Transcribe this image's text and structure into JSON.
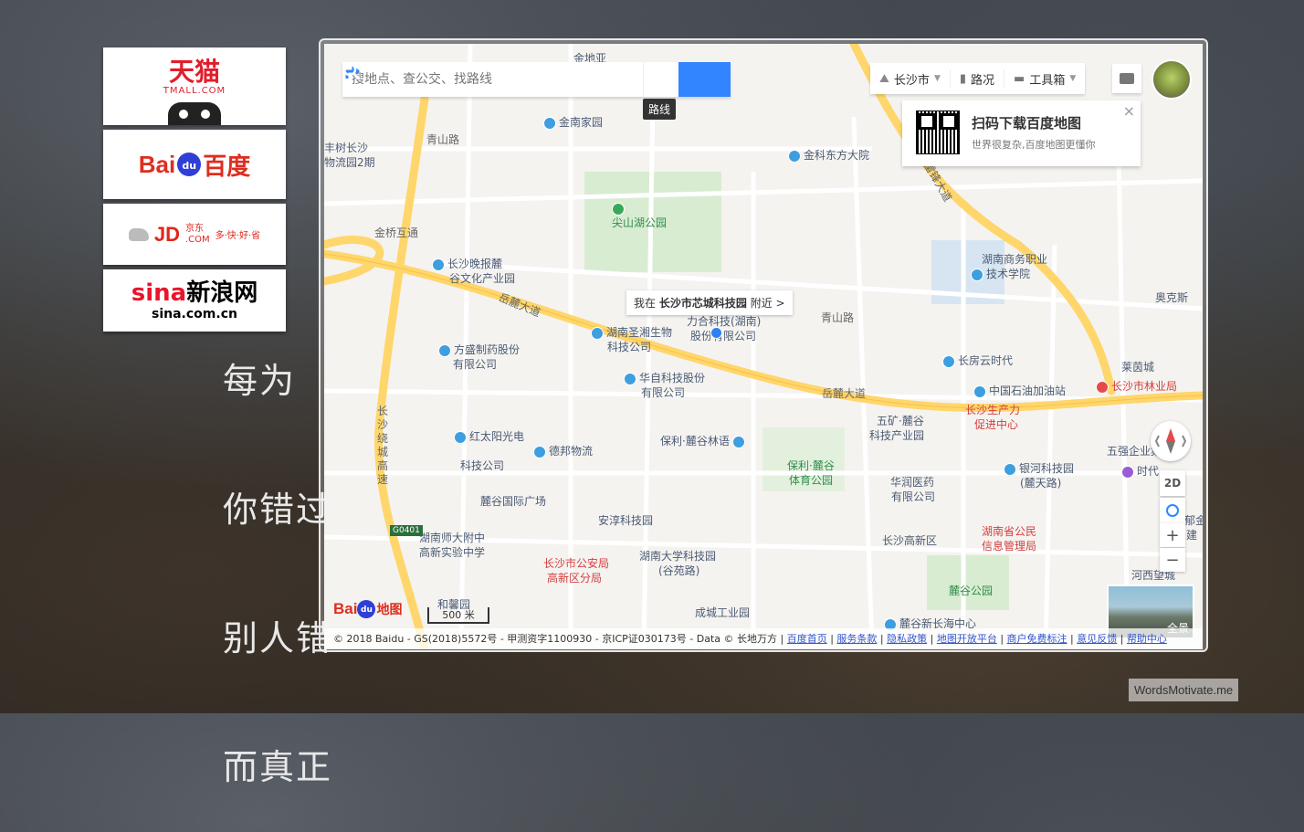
{
  "background_text": [
    "每为",
    "你错过",
    "别人错",
    "而真正"
  ],
  "links": {
    "tmall": {
      "cn": "天猫",
      "en": "TMALL.COM"
    },
    "baidu": {
      "left": "Bai",
      "paw": "du",
      "right": "百度"
    },
    "jd": {
      "logo": "JD",
      "cn": "京东",
      "com": ".COM",
      "slogan": "多·快·好·省"
    },
    "sina": {
      "logo_red": "sina",
      "logo_black": "新浪网",
      "url": "sina.com.cn"
    }
  },
  "search": {
    "placeholder": "搜地点、查公交、找路线",
    "route_tooltip": "路线",
    "route_icon": "route-arrow-icon",
    "search_icon": "magnifier-icon"
  },
  "toolbar": {
    "city": "长沙市",
    "traffic": "路况",
    "tools": "工具箱"
  },
  "qr_card": {
    "title": "扫码下载百度地图",
    "subtitle": "世界很复杂,百度地图更懂你",
    "close": "×"
  },
  "location_tip": {
    "prefix": "我在",
    "place": "长沙市芯城科技园",
    "suffix": "附近 >"
  },
  "controls": {
    "mode": "2D",
    "zoom_in": "+",
    "zoom_out": "−",
    "overview": "全景"
  },
  "scale": "500 米",
  "logo": {
    "bai": "Bai",
    "du": "du",
    "map": "地图"
  },
  "copyright": {
    "text": "© 2018 Baidu - GS(2018)5572号 - 甲测资字1100930 - 京ICP证030173号 - Data © 长地万方 |",
    "links": [
      "百度首页",
      "服务条款",
      "隐私政策",
      "地图开放平台",
      "商户免费标注",
      "意见反馈",
      "帮助中心"
    ]
  },
  "map_labels": [
    {
      "text": "金地亚",
      "type": "poi"
    },
    {
      "text": "金南家园",
      "type": "poi"
    },
    {
      "text": "青山路",
      "type": "road"
    },
    {
      "text": "丰树长沙",
      "type": "poi"
    },
    {
      "text": "物流园2期",
      "type": "poi"
    },
    {
      "text": "金科东方大院",
      "type": "poi"
    },
    {
      "text": "尖山湖公园",
      "type": "park"
    },
    {
      "text": "金桥互通",
      "type": "road"
    },
    {
      "text": "长沙晚报麓",
      "type": "poi"
    },
    {
      "text": "谷文化产业园",
      "type": "poi"
    },
    {
      "text": "岳麓大道",
      "type": "road"
    },
    {
      "text": "湖南圣湘生物",
      "type": "poi"
    },
    {
      "text": "科技公司",
      "type": "poi"
    },
    {
      "text": "力合科技(湖南)",
      "type": "poi"
    },
    {
      "text": "股份有限公司",
      "type": "poi"
    },
    {
      "text": "青山路",
      "type": "road"
    },
    {
      "text": "方盛制药股份",
      "type": "poi"
    },
    {
      "text": "有限公司",
      "type": "poi"
    },
    {
      "text": "华自科技股份",
      "type": "poi"
    },
    {
      "text": "有限公司",
      "type": "poi"
    },
    {
      "text": "岳麓大道",
      "type": "road"
    },
    {
      "text": "长沙绕城高速",
      "type": "road"
    },
    {
      "text": "红太阳光电",
      "type": "poi"
    },
    {
      "text": "科技公司",
      "type": "poi"
    },
    {
      "text": "德邦物流",
      "type": "poi"
    },
    {
      "text": "保利·麓谷林语",
      "type": "poi"
    },
    {
      "text": "保利·麓谷",
      "type": "park"
    },
    {
      "text": "体育公园",
      "type": "park"
    },
    {
      "text": "麓谷国际广场",
      "type": "poi"
    },
    {
      "text": "安淳科技园",
      "type": "poi"
    },
    {
      "text": "湖南师大附中",
      "type": "poi"
    },
    {
      "text": "高新实验中学",
      "type": "poi"
    },
    {
      "text": "长沙市公安局",
      "type": "red"
    },
    {
      "text": "高新区分局",
      "type": "red"
    },
    {
      "text": "湖南大学科技园",
      "type": "poi"
    },
    {
      "text": "(谷苑路)",
      "type": "poi"
    },
    {
      "text": "和馨园",
      "type": "poi"
    },
    {
      "text": "成城工业园",
      "type": "poi"
    },
    {
      "text": "雷锋大道",
      "type": "road"
    },
    {
      "text": "湖南商务职业",
      "type": "poi"
    },
    {
      "text": "技术学院",
      "type": "poi"
    },
    {
      "text": "长房云时代",
      "type": "poi"
    },
    {
      "text": "中国石油加油站",
      "type": "poi"
    },
    {
      "text": "长沙市林业局",
      "type": "red"
    },
    {
      "text": "长沙生产力",
      "type": "red"
    },
    {
      "text": "促进中心",
      "type": "red"
    },
    {
      "text": "五矿·麓谷",
      "type": "poi"
    },
    {
      "text": "科技产业园",
      "type": "poi"
    },
    {
      "text": "华润医药",
      "type": "poi"
    },
    {
      "text": "有限公司",
      "type": "poi"
    },
    {
      "text": "银河科技园",
      "type": "poi"
    },
    {
      "text": "(麓天路)",
      "type": "poi"
    },
    {
      "text": "五强企业集团",
      "type": "poi"
    },
    {
      "text": "时代",
      "type": "poi"
    },
    {
      "text": "湖南省公民",
      "type": "red"
    },
    {
      "text": "信息管理局",
      "type": "red"
    },
    {
      "text": "长沙高新区",
      "type": "poi"
    },
    {
      "text": "麓谷公园",
      "type": "park"
    },
    {
      "text": "麓谷新长海中心",
      "type": "poi"
    },
    {
      "text": "河西望城",
      "type": "poi"
    },
    {
      "text": "莱茵城",
      "type": "poi"
    },
    {
      "text": "奥克斯",
      "type": "poi"
    },
    {
      "text": "郁金",
      "type": "poi"
    },
    {
      "text": "建",
      "type": "poi"
    },
    {
      "text": "G0401",
      "type": "shield"
    }
  ],
  "watermark": "WordsMotivate.me"
}
